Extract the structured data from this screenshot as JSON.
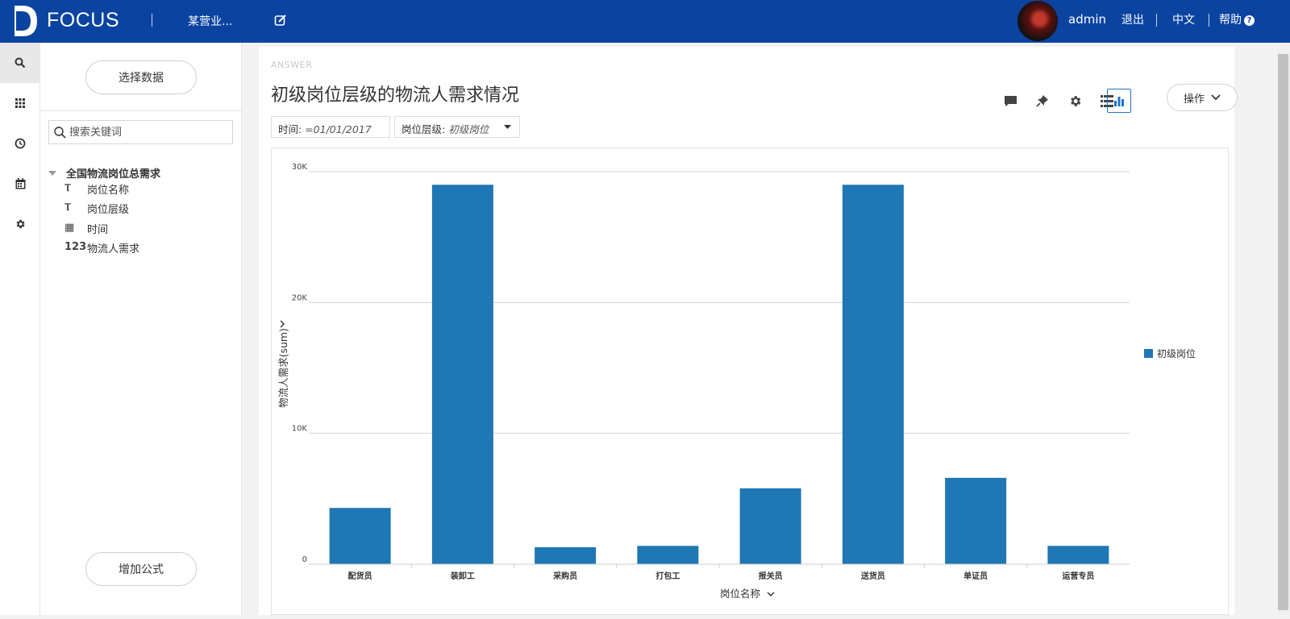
{
  "app": {
    "brand": "FOCUS",
    "project_name": "某营业...",
    "user": "admin",
    "logout": "退出",
    "language": "中文",
    "help": "帮助"
  },
  "rail": {
    "icons": [
      "search-icon",
      "apps-grid-icon",
      "history-icon",
      "calendar-icon",
      "settings-icon"
    ],
    "active": "search-icon"
  },
  "panel": {
    "select_data_label": "选择数据",
    "search_placeholder": "搜索关键词",
    "table_name": "全国物流岗位总需求",
    "fields": [
      {
        "type_icon": "Ⲧ",
        "label": "岗位名称"
      },
      {
        "type_icon": "Ⲧ",
        "label": "岗位层级"
      },
      {
        "type_icon": "▦",
        "label": "时间"
      },
      {
        "type_icon": "123",
        "label": "物流人需求"
      }
    ],
    "add_formula_label": "增加公式"
  },
  "answer": {
    "tag": "ANSWER",
    "title": "初级岗位层级的物流人需求情况",
    "ops_label": "操作",
    "filters": [
      {
        "key": "时间:",
        "value": "=01/01/2017"
      },
      {
        "key": "岗位层级:",
        "value": "初级岗位"
      }
    ],
    "toolbar_icons": [
      "comment-icon",
      "pin-icon",
      "gear-icon",
      "table-view-icon",
      "chart-view-icon"
    ]
  },
  "colors": {
    "topbar": "#0a43a0",
    "bar": "#1f77b4",
    "accent": "#1f74c9"
  },
  "chart_data": {
    "type": "bar",
    "categories": [
      "配货员",
      "装卸工",
      "采购员",
      "打包工",
      "报关员",
      "送货员",
      "单证员",
      "运营专员"
    ],
    "series": [
      {
        "name": "初级岗位",
        "values": [
          4300,
          29000,
          1300,
          1400,
          5800,
          29000,
          6600,
          1400
        ]
      }
    ],
    "xlabel": "岗位名称",
    "ylabel": "物流人需求(sum)",
    "ylim": [
      0,
      30000
    ],
    "yticks": [
      0,
      10000,
      20000,
      30000
    ],
    "ytick_labels": [
      "0",
      "10K",
      "20K",
      "30K"
    ],
    "grid": true,
    "legend": "right"
  }
}
